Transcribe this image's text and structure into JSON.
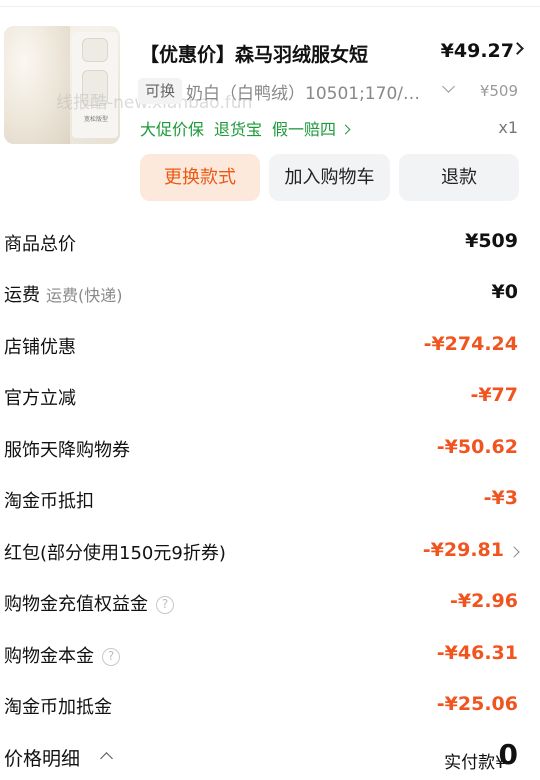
{
  "product": {
    "title": "【优惠价】森马羽绒服女短",
    "price": "¥49.27",
    "swap_tag": "可换",
    "spec": "奶白（白鸭绒）10501;170/…",
    "original_price": "¥509",
    "promos": [
      "大促价保",
      "退货宝",
      "假一赔四"
    ],
    "quantity": "x1",
    "thumbnail_caption": "宽松版型",
    "watermark": "线报酷-new.xianbao.fun"
  },
  "actions": {
    "swap_style": "更换款式",
    "add_to_cart": "加入购物车",
    "refund": "退款"
  },
  "fees": [
    {
      "label": "商品总价",
      "sub": "",
      "value": "¥509",
      "kind": "neutral"
    },
    {
      "label": "运费",
      "sub": "运费(快递)",
      "value": "¥0",
      "kind": "neutral"
    },
    {
      "label": "店铺优惠",
      "sub": "",
      "value": "-¥274.24",
      "kind": "discount"
    },
    {
      "label": "官方立减",
      "sub": "",
      "value": "-¥77",
      "kind": "discount"
    },
    {
      "label": "服饰天降购物券",
      "sub": "",
      "value": "-¥50.62",
      "kind": "discount"
    },
    {
      "label": "淘金币抵扣",
      "sub": "",
      "value": "-¥3",
      "kind": "discount"
    },
    {
      "label": "红包(部分使用150元9折券)",
      "sub": "",
      "value": "-¥29.81",
      "kind": "discount"
    },
    {
      "label": "购物金充值权益金",
      "sub": "",
      "value": "-¥2.96",
      "kind": "discount"
    },
    {
      "label": "购物金本金",
      "sub": "",
      "value": "-¥46.31",
      "kind": "discount"
    },
    {
      "label": "淘金币加抵金",
      "sub": "",
      "value": "-¥25.06",
      "kind": "discount"
    }
  ],
  "footer": {
    "price_details": "价格明细",
    "paid_label": "实付款",
    "paid_symbol": "¥",
    "paid_value": "0"
  },
  "colors": {
    "discount": "#f0541f",
    "promo_green": "#1d9a3a",
    "swap_button_bg": "#fde8dc",
    "swap_button_text": "#ea5a12"
  }
}
